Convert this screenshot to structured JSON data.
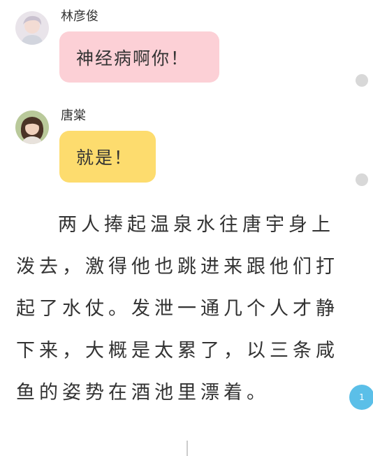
{
  "messages": [
    {
      "sender": "林彦俊",
      "text": "神经病啊你！",
      "avatar_icon": "user-avatar-icon",
      "bubble_color": "#fcd0d6"
    },
    {
      "sender": "唐棠",
      "text": "就是！",
      "avatar_icon": "user-avatar-icon",
      "bubble_color": "#fddc6e"
    }
  ],
  "narration": "两人捧起温泉水往唐宇身上泼去，激得他也跳进来跟他们打起了水仗。发泄一通几个人才静下来，大概是太累了，以三条咸鱼的姿势在酒池里漂着。",
  "page_badge": "1",
  "colors": {
    "accent": "#5bbfe8",
    "side_dot": "#d8d8d8"
  }
}
